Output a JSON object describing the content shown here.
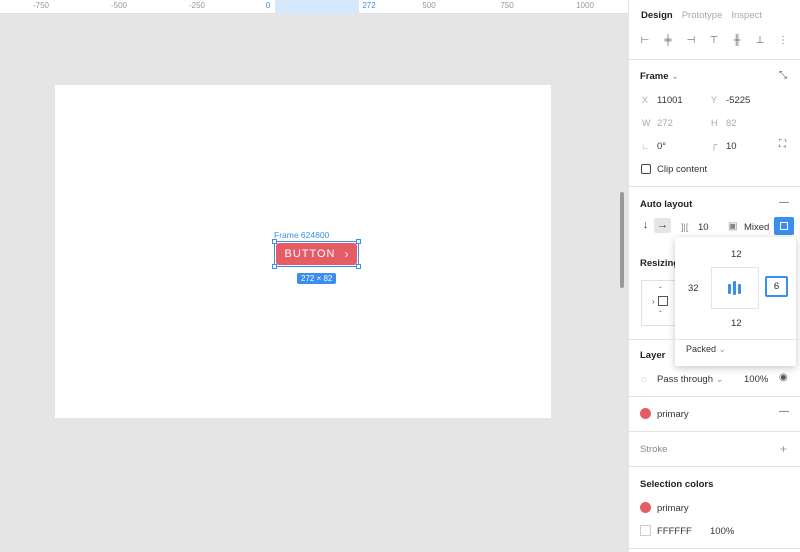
{
  "ruler": {
    "ticks": [
      "-750",
      "-500",
      "-250",
      "0",
      "272",
      "500",
      "750",
      "1000"
    ]
  },
  "canvas": {
    "frame_name": "Frame 624800",
    "button_label": "BUTTON",
    "button_chevron": "›",
    "size_badge": "272 × 82",
    "colors": {
      "button": "#e55c67",
      "selection": "#3a8ef0"
    }
  },
  "panel": {
    "tabs": [
      "Design",
      "Prototype",
      "Inspect"
    ],
    "frame_section": {
      "title": "Frame",
      "x_label": "X",
      "x_value": "11001",
      "y_label": "Y",
      "y_value": "-5225",
      "w_label": "W",
      "w_value": "272",
      "h_label": "H",
      "h_value": "82",
      "rotation": "0°",
      "radius": "10",
      "clip_content": "Clip content"
    },
    "auto_layout": {
      "title": "Auto layout",
      "spacing": "10",
      "padding": "Mixed",
      "popover": {
        "top": "12",
        "left": "32",
        "right": "6",
        "bottom": "12",
        "mode": "Packed"
      }
    },
    "resizing": {
      "title": "Resizing"
    },
    "layer": {
      "title": "Layer",
      "blend": "Pass through",
      "opacity": "100%"
    },
    "fill": {
      "name": "primary",
      "color": "#e55c67"
    },
    "stroke": {
      "title": "Stroke"
    },
    "selection_colors": {
      "title": "Selection colors",
      "items": [
        {
          "name": "primary",
          "color": "#e55c67"
        },
        {
          "name": "FFFFFF",
          "opacity": "100%"
        }
      ]
    }
  }
}
